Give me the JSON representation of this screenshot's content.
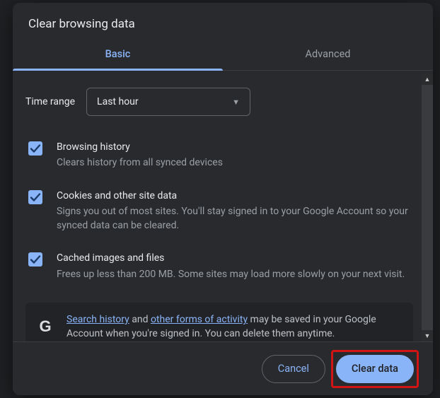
{
  "dialog": {
    "title": "Clear browsing data"
  },
  "tabs": {
    "basic": "Basic",
    "advanced": "Advanced"
  },
  "timeRange": {
    "label": "Time range",
    "value": "Last hour"
  },
  "options": {
    "browsing": {
      "title": "Browsing history",
      "desc": "Clears history from all synced devices"
    },
    "cookies": {
      "title": "Cookies and other site data",
      "desc": "Signs you out of most sites. You'll stay signed in to your Google Account so your synced data can be cleared."
    },
    "cache": {
      "title": "Cached images and files",
      "desc": "Frees up less than 200 MB. Some sites may load more slowly on your next visit."
    }
  },
  "notice": {
    "link1": "Search history",
    "mid1": " and ",
    "link2": "other forms of activity",
    "tail": " may be saved in your Google Account when you're signed in. You can delete them anytime."
  },
  "footer": {
    "cancel": "Cancel",
    "clear": "Clear data"
  }
}
